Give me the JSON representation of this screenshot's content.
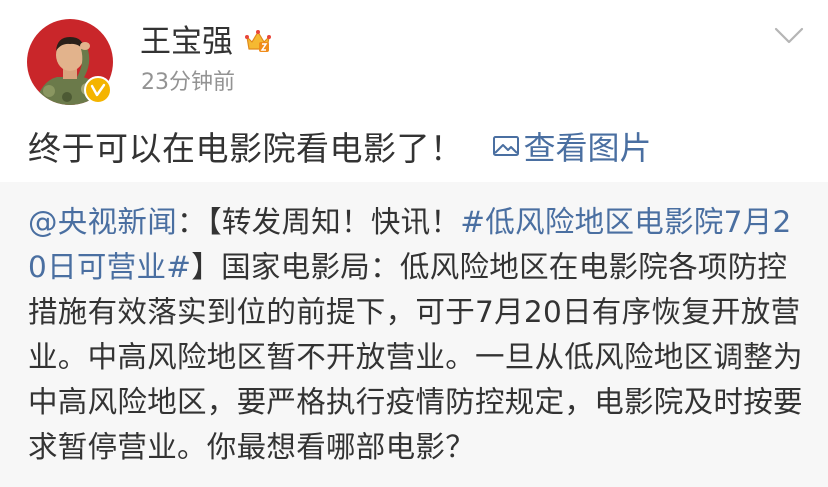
{
  "user": {
    "name": "王宝强",
    "timestamp": "23分钟前",
    "avatar_color": "#c9262a",
    "verified_badge_color": "#f4b400"
  },
  "post": {
    "text": "终于可以在电影院看电影了！",
    "view_pic_label": "查看图片"
  },
  "repost": {
    "mention": "@央视新闻",
    "colon": "：",
    "tag_prefix": "【转发周知！快讯！",
    "hashtag": "#低风险地区电影院7月20日可营业#",
    "body": "】国家电影局：低风险地区在电影院各项防控措施有效落实到位的前提下，可于7月20日有序恢复开放营业。中高风险地区暂不开放营业。一旦从低风险地区调整为中高风险地区，要严格执行疫情防控规定，电影院及时按要求暂停营业。你最想看哪部电影？"
  },
  "colors": {
    "link": "#4a6fa1",
    "text": "#333333",
    "muted": "#939393",
    "repost_bg": "#f7f7f7"
  }
}
